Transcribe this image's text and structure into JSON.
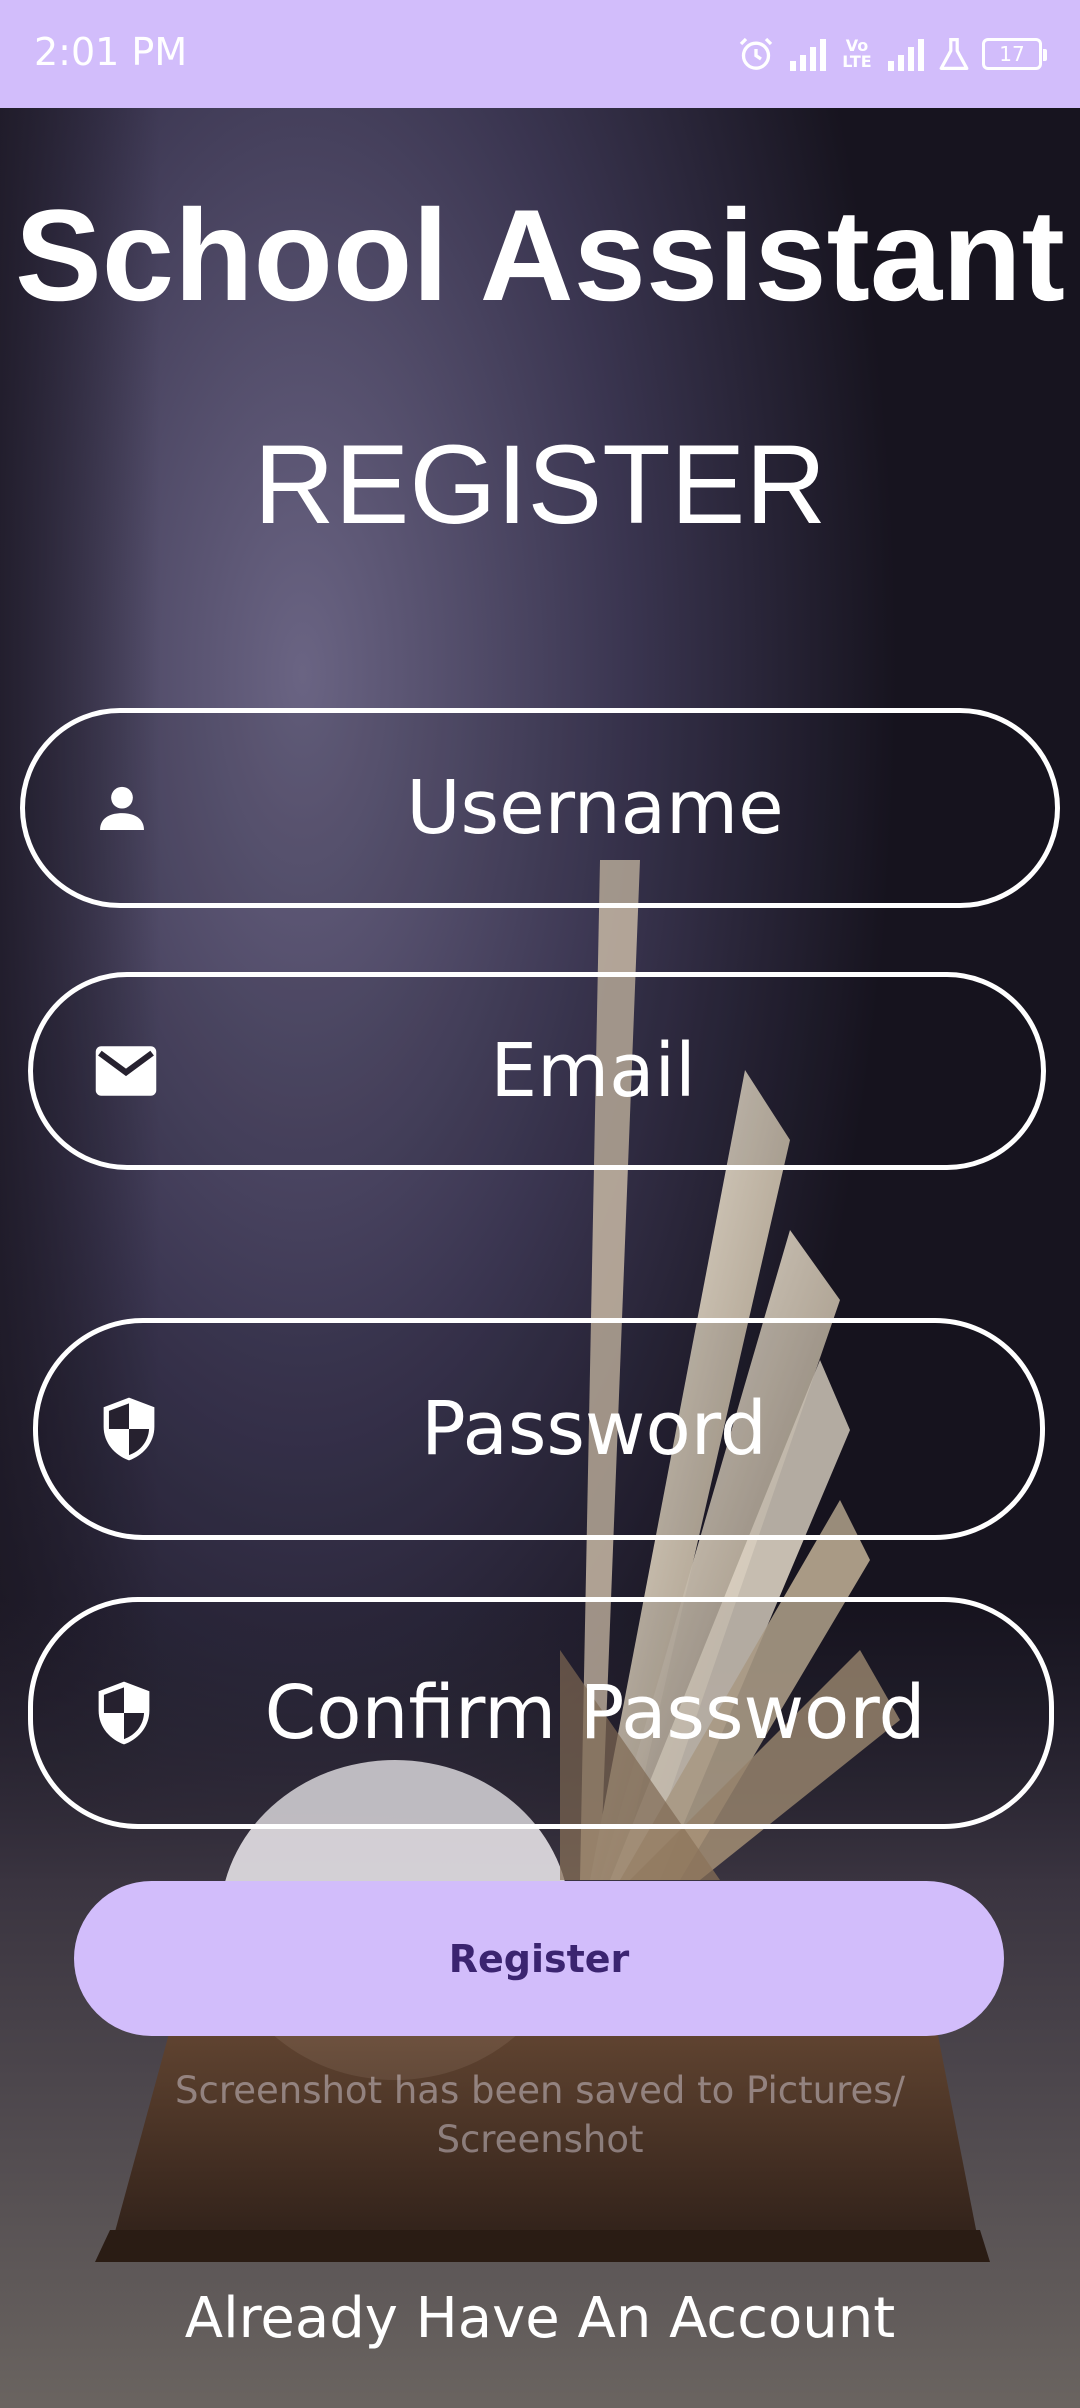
{
  "status_bar": {
    "time": "2:01 PM",
    "network_badge": "Vo LTE",
    "battery_level": "17",
    "background_color": "#d2bdfb",
    "icons": [
      "alarm-icon",
      "signal-icon",
      "volte-icon",
      "signal-icon",
      "lab-icon",
      "battery-icon"
    ]
  },
  "app": {
    "title": "School Assistant",
    "heading": "REGISTER"
  },
  "form": {
    "username": {
      "placeholder": "Username",
      "icon": "person-icon"
    },
    "email": {
      "placeholder": "Email",
      "icon": "mail-icon"
    },
    "password": {
      "placeholder": "Password",
      "icon": "shield-icon"
    },
    "confirm_password": {
      "placeholder": "Confirm Password",
      "icon": "shield-icon"
    },
    "register_label": "Register",
    "register_color": "#d2bdfb"
  },
  "toast": {
    "message": "Screenshot has been saved to  Pictures/ Screenshot"
  },
  "footer": {
    "login_link": "Already Have An Account"
  }
}
